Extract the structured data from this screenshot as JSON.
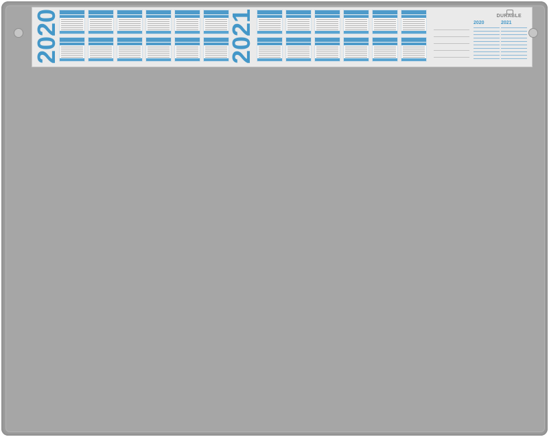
{
  "product": {
    "brand": "DURABLE",
    "years": [
      "2020",
      "2021"
    ],
    "holiday_years": [
      "2020",
      "2021"
    ],
    "accent_color": "#1f8ac8",
    "mat_color": "#9d9d9d"
  }
}
